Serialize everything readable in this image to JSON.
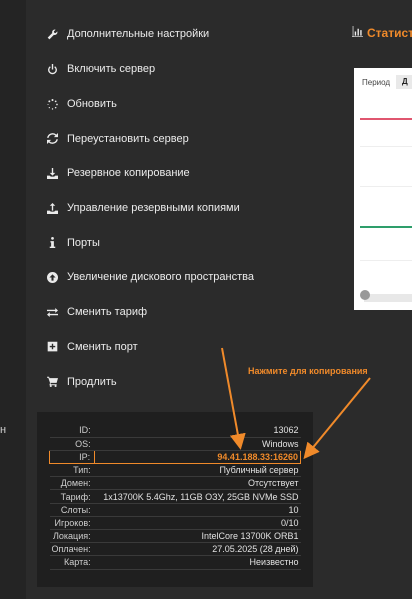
{
  "menu": [
    {
      "label": "Дополнительные настройки",
      "icon": "wrench-icon"
    },
    {
      "label": "Включить сервер",
      "icon": "power-icon"
    },
    {
      "label": "Обновить",
      "icon": "spinner-icon"
    },
    {
      "label": "Переустановить сервер",
      "icon": "refresh-icon"
    },
    {
      "label": "Резервное копирование",
      "icon": "download-icon"
    },
    {
      "label": "Управление резервными копиями",
      "icon": "upload-icon"
    },
    {
      "label": "Порты",
      "icon": "info-icon"
    },
    {
      "label": "Увеличение дискового пространства",
      "icon": "arrow-up-circle-icon"
    },
    {
      "label": "Сменить тариф",
      "icon": "exchange-icon"
    },
    {
      "label": "Сменить порт",
      "icon": "plus-square-icon"
    },
    {
      "label": "Продлить",
      "icon": "cart-icon"
    }
  ],
  "left_edge_char": "н",
  "stats": {
    "title": "Статист",
    "period_label": "Период",
    "period_tab": "Д"
  },
  "hint": "Нажмите для копирования",
  "info": [
    {
      "key": "ID:",
      "value": "13062"
    },
    {
      "key": "OS:",
      "value": "Windows"
    },
    {
      "key": "IP:",
      "value": "94.41.188.33:16260"
    },
    {
      "key": "Тип:",
      "value": "Публичный сервер"
    },
    {
      "key": "Домен:",
      "value": "Отсутствует"
    },
    {
      "key": "Тариф:",
      "value": "1x13700K 5.4Ghz, 11GB ОЗУ, 25GB NVMe SSD"
    },
    {
      "key": "Слоты:",
      "value": "10"
    },
    {
      "key": "Игроков:",
      "value": "0/10"
    },
    {
      "key": "Локация:",
      "value": "IntelCore 13700K ORB1"
    },
    {
      "key": "Оплачен:",
      "value": "27.05.2025 (28 дней)"
    },
    {
      "key": "Карта:",
      "value": "Неизвестно"
    }
  ],
  "colors": {
    "accent": "#f08a2a",
    "background": "#2b2b2b",
    "panel": "#1f1f1f"
  }
}
